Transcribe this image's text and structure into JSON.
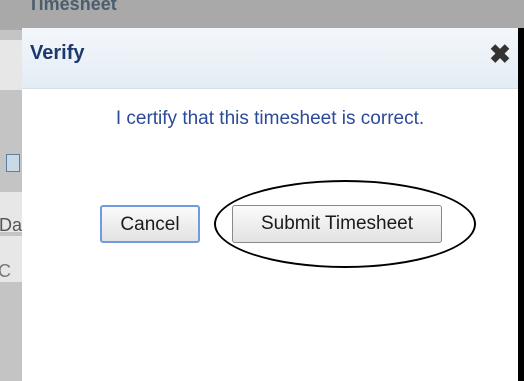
{
  "background": {
    "page_title": "Timesheet",
    "label_fragment": "Da",
    "cell_fragment": "C"
  },
  "dialog": {
    "title": "Verify",
    "close_icon": "close-icon",
    "message": "I certify that this timesheet is correct.",
    "buttons": {
      "cancel": "Cancel",
      "submit": "Submit Timesheet"
    }
  },
  "colors": {
    "title": "#1c3a6e",
    "message": "#2b4a9a",
    "focus_border": "#6f9ce0"
  }
}
